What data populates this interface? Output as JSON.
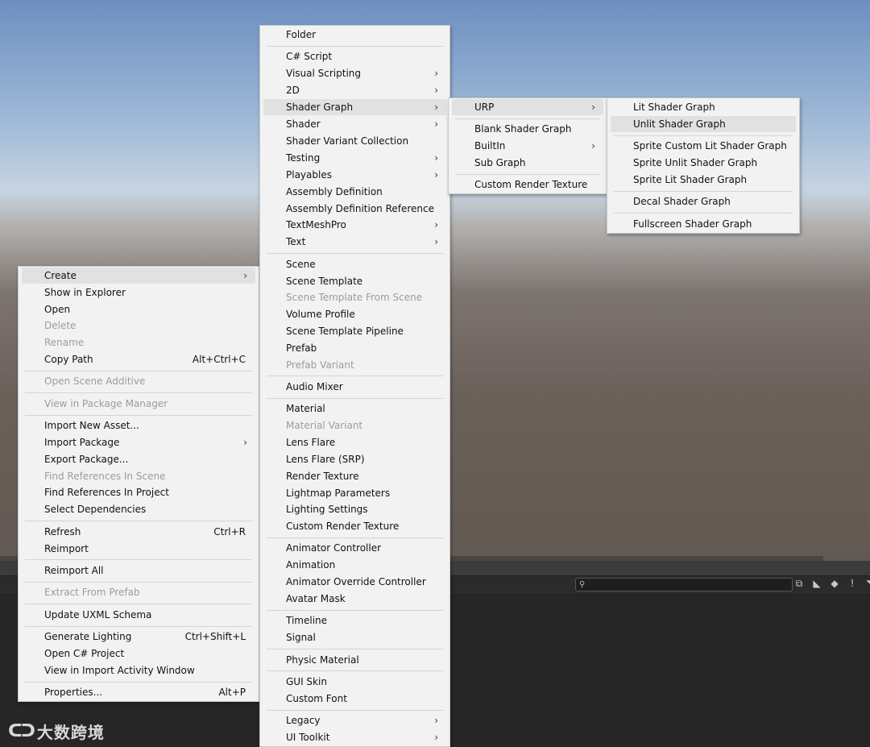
{
  "context_menu": {
    "items": [
      {
        "label": "Create",
        "shortcut": "",
        "submenu": true,
        "disabled": false
      },
      {
        "label": "Show in Explorer",
        "shortcut": "",
        "submenu": false,
        "disabled": false
      },
      {
        "label": "Open",
        "shortcut": "",
        "submenu": false,
        "disabled": false
      },
      {
        "label": "Delete",
        "shortcut": "",
        "submenu": false,
        "disabled": true
      },
      {
        "label": "Rename",
        "shortcut": "",
        "submenu": false,
        "disabled": true
      },
      {
        "label": "Copy Path",
        "shortcut": "Alt+Ctrl+C",
        "submenu": false,
        "disabled": false
      },
      {
        "label": "Open Scene Additive",
        "shortcut": "",
        "submenu": false,
        "disabled": true
      },
      {
        "label": "View in Package Manager",
        "shortcut": "",
        "submenu": false,
        "disabled": true
      },
      {
        "label": "Import New Asset...",
        "shortcut": "",
        "submenu": false,
        "disabled": false
      },
      {
        "label": "Import Package",
        "shortcut": "",
        "submenu": true,
        "disabled": false
      },
      {
        "label": "Export Package...",
        "shortcut": "",
        "submenu": false,
        "disabled": false
      },
      {
        "label": "Find References In Scene",
        "shortcut": "",
        "submenu": false,
        "disabled": true
      },
      {
        "label": "Find References In Project",
        "shortcut": "",
        "submenu": false,
        "disabled": false
      },
      {
        "label": "Select Dependencies",
        "shortcut": "",
        "submenu": false,
        "disabled": false
      },
      {
        "label": "Refresh",
        "shortcut": "Ctrl+R",
        "submenu": false,
        "disabled": false
      },
      {
        "label": "Reimport",
        "shortcut": "",
        "submenu": false,
        "disabled": false
      },
      {
        "label": "Reimport All",
        "shortcut": "",
        "submenu": false,
        "disabled": false
      },
      {
        "label": "Extract From Prefab",
        "shortcut": "",
        "submenu": false,
        "disabled": true
      },
      {
        "label": "Update UXML Schema",
        "shortcut": "",
        "submenu": false,
        "disabled": false
      },
      {
        "label": "Generate Lighting",
        "shortcut": "Ctrl+Shift+L",
        "submenu": false,
        "disabled": false
      },
      {
        "label": "Open C# Project",
        "shortcut": "",
        "submenu": false,
        "disabled": false
      },
      {
        "label": "View in Import Activity Window",
        "shortcut": "",
        "submenu": false,
        "disabled": false
      },
      {
        "label": "Properties...",
        "shortcut": "Alt+P",
        "submenu": false,
        "disabled": false
      }
    ]
  },
  "create_menu": {
    "items": [
      {
        "label": "Folder",
        "submenu": false,
        "disabled": false
      },
      {
        "label": "C# Script",
        "submenu": false,
        "disabled": false
      },
      {
        "label": "Visual Scripting",
        "submenu": true,
        "disabled": false
      },
      {
        "label": "2D",
        "submenu": true,
        "disabled": false
      },
      {
        "label": "Shader Graph",
        "submenu": true,
        "disabled": false
      },
      {
        "label": "Shader",
        "submenu": true,
        "disabled": false
      },
      {
        "label": "Shader Variant Collection",
        "submenu": false,
        "disabled": false
      },
      {
        "label": "Testing",
        "submenu": true,
        "disabled": false
      },
      {
        "label": "Playables",
        "submenu": true,
        "disabled": false
      },
      {
        "label": "Assembly Definition",
        "submenu": false,
        "disabled": false
      },
      {
        "label": "Assembly Definition Reference",
        "submenu": false,
        "disabled": false
      },
      {
        "label": "TextMeshPro",
        "submenu": true,
        "disabled": false
      },
      {
        "label": "Text",
        "submenu": true,
        "disabled": false
      },
      {
        "label": "Scene",
        "submenu": false,
        "disabled": false
      },
      {
        "label": "Scene Template",
        "submenu": false,
        "disabled": false
      },
      {
        "label": "Scene Template From Scene",
        "submenu": false,
        "disabled": true
      },
      {
        "label": "Volume Profile",
        "submenu": false,
        "disabled": false
      },
      {
        "label": "Scene Template Pipeline",
        "submenu": false,
        "disabled": false
      },
      {
        "label": "Prefab",
        "submenu": false,
        "disabled": false
      },
      {
        "label": "Prefab Variant",
        "submenu": false,
        "disabled": true
      },
      {
        "label": "Audio Mixer",
        "submenu": false,
        "disabled": false
      },
      {
        "label": "Material",
        "submenu": false,
        "disabled": false
      },
      {
        "label": "Material Variant",
        "submenu": false,
        "disabled": true
      },
      {
        "label": "Lens Flare",
        "submenu": false,
        "disabled": false
      },
      {
        "label": "Lens Flare (SRP)",
        "submenu": false,
        "disabled": false
      },
      {
        "label": "Render Texture",
        "submenu": false,
        "disabled": false
      },
      {
        "label": "Lightmap Parameters",
        "submenu": false,
        "disabled": false
      },
      {
        "label": "Lighting Settings",
        "submenu": false,
        "disabled": false
      },
      {
        "label": "Custom Render Texture",
        "submenu": false,
        "disabled": false
      },
      {
        "label": "Animator Controller",
        "submenu": false,
        "disabled": false
      },
      {
        "label": "Animation",
        "submenu": false,
        "disabled": false
      },
      {
        "label": "Animator Override Controller",
        "submenu": false,
        "disabled": false
      },
      {
        "label": "Avatar Mask",
        "submenu": false,
        "disabled": false
      },
      {
        "label": "Timeline",
        "submenu": false,
        "disabled": false
      },
      {
        "label": "Signal",
        "submenu": false,
        "disabled": false
      },
      {
        "label": "Physic Material",
        "submenu": false,
        "disabled": false
      },
      {
        "label": "GUI Skin",
        "submenu": false,
        "disabled": false
      },
      {
        "label": "Custom Font",
        "submenu": false,
        "disabled": false
      },
      {
        "label": "Legacy",
        "submenu": true,
        "disabled": false
      },
      {
        "label": "UI Toolkit",
        "submenu": true,
        "disabled": false
      }
    ]
  },
  "shader_graph_menu": {
    "items": [
      {
        "label": "URP",
        "submenu": true
      },
      {
        "label": "Blank Shader Graph",
        "submenu": false
      },
      {
        "label": "BuiltIn",
        "submenu": true
      },
      {
        "label": "Sub Graph",
        "submenu": false
      },
      {
        "label": "Custom Render Texture",
        "submenu": false
      }
    ]
  },
  "urp_menu": {
    "items": [
      {
        "label": "Lit Shader Graph"
      },
      {
        "label": "Unlit Shader Graph"
      },
      {
        "label": "Sprite Custom Lit Shader Graph"
      },
      {
        "label": "Sprite Unlit Shader Graph"
      },
      {
        "label": "Sprite Lit Shader Graph"
      },
      {
        "label": "Decal Shader Graph"
      },
      {
        "label": "Fullscreen Shader Graph"
      }
    ]
  },
  "submenu_arrow": "›",
  "toolbar": {
    "search_placeholder": "",
    "search_icon": "⚲",
    "icons": [
      "⧉",
      "◣",
      "◆",
      "!",
      "◥"
    ]
  },
  "watermark": {
    "logo": "ᑕᑐ",
    "text": "大数跨境"
  }
}
